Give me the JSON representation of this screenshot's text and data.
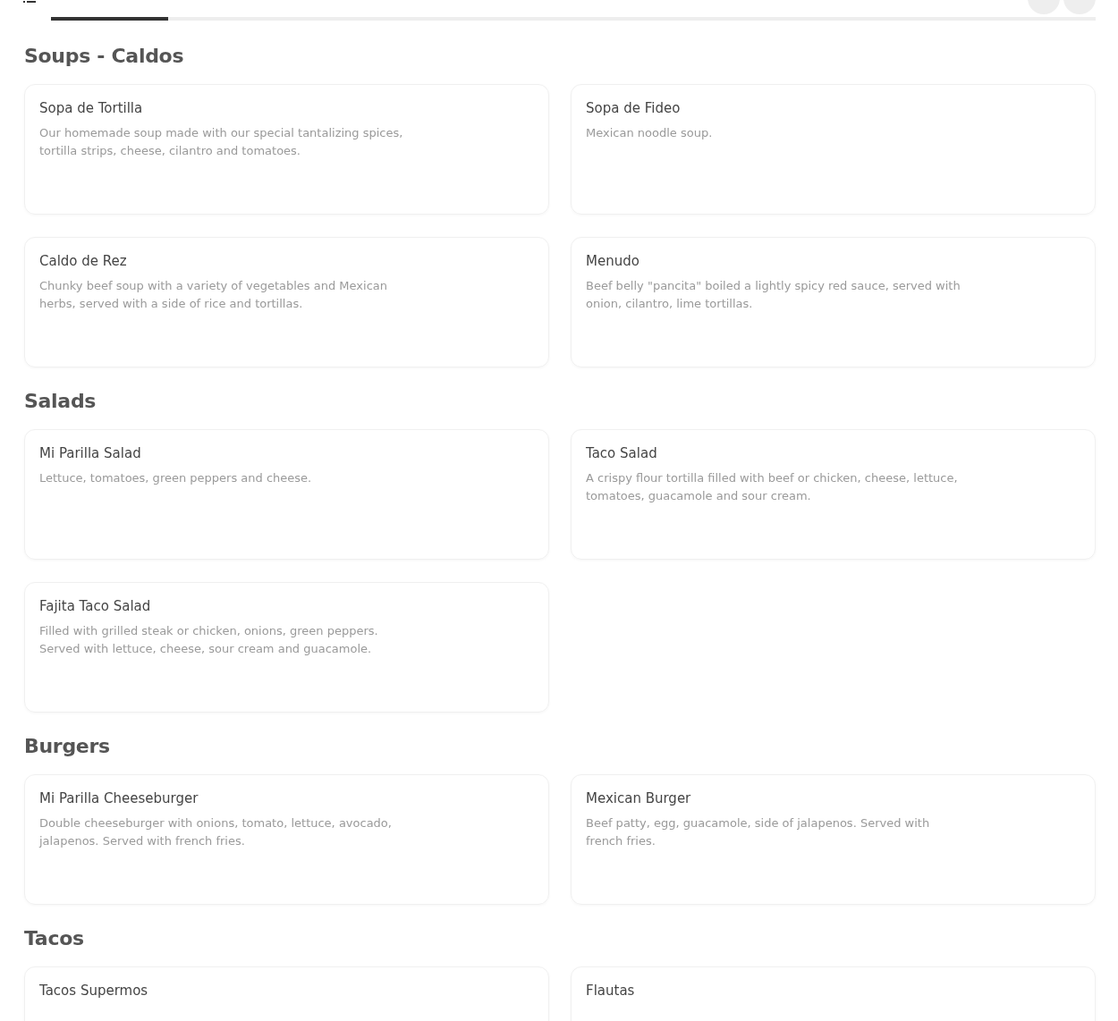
{
  "sections": [
    {
      "title": "Soups - Caldos",
      "items": [
        {
          "name": "Sopa de Tortilla",
          "description": "Our homemade soup made with our special tantalizing spices, tortilla strips, cheese, cilantro and tomatoes."
        },
        {
          "name": "Sopa de Fideo",
          "description": "Mexican noodle soup."
        },
        {
          "name": "Caldo de Rez",
          "description": "Chunky beef soup with a variety of vegetables and Mexican herbs, served with a side of rice and tortillas."
        },
        {
          "name": "Menudo",
          "description": "Beef belly \"pancita\" boiled a lightly spicy red sauce, served with onion, cilantro, lime tortillas."
        }
      ]
    },
    {
      "title": "Salads",
      "items": [
        {
          "name": "Mi Parilla Salad",
          "description": "Lettuce, tomatoes, green peppers and cheese."
        },
        {
          "name": "Taco Salad",
          "description": "A crispy flour tortilla filled with beef or chicken, cheese, lettuce, tomatoes, guacamole and sour cream."
        },
        {
          "name": "Fajita Taco Salad",
          "description": "Filled with grilled steak or chicken, onions, green peppers. Served with lettuce, cheese, sour cream and guacamole."
        }
      ]
    },
    {
      "title": "Burgers",
      "items": [
        {
          "name": "Mi Parilla Cheeseburger",
          "description": "Double cheeseburger with onions, tomato, lettuce, avocado, jalapenos. Served with french fries."
        },
        {
          "name": "Mexican Burger",
          "description": "Beef patty, egg, guacamole, side of jalapenos. Served with french fries."
        }
      ]
    },
    {
      "title": "Tacos",
      "items": [
        {
          "name": "Tacos Supermos"
        },
        {
          "name": "Flautas"
        }
      ]
    }
  ]
}
